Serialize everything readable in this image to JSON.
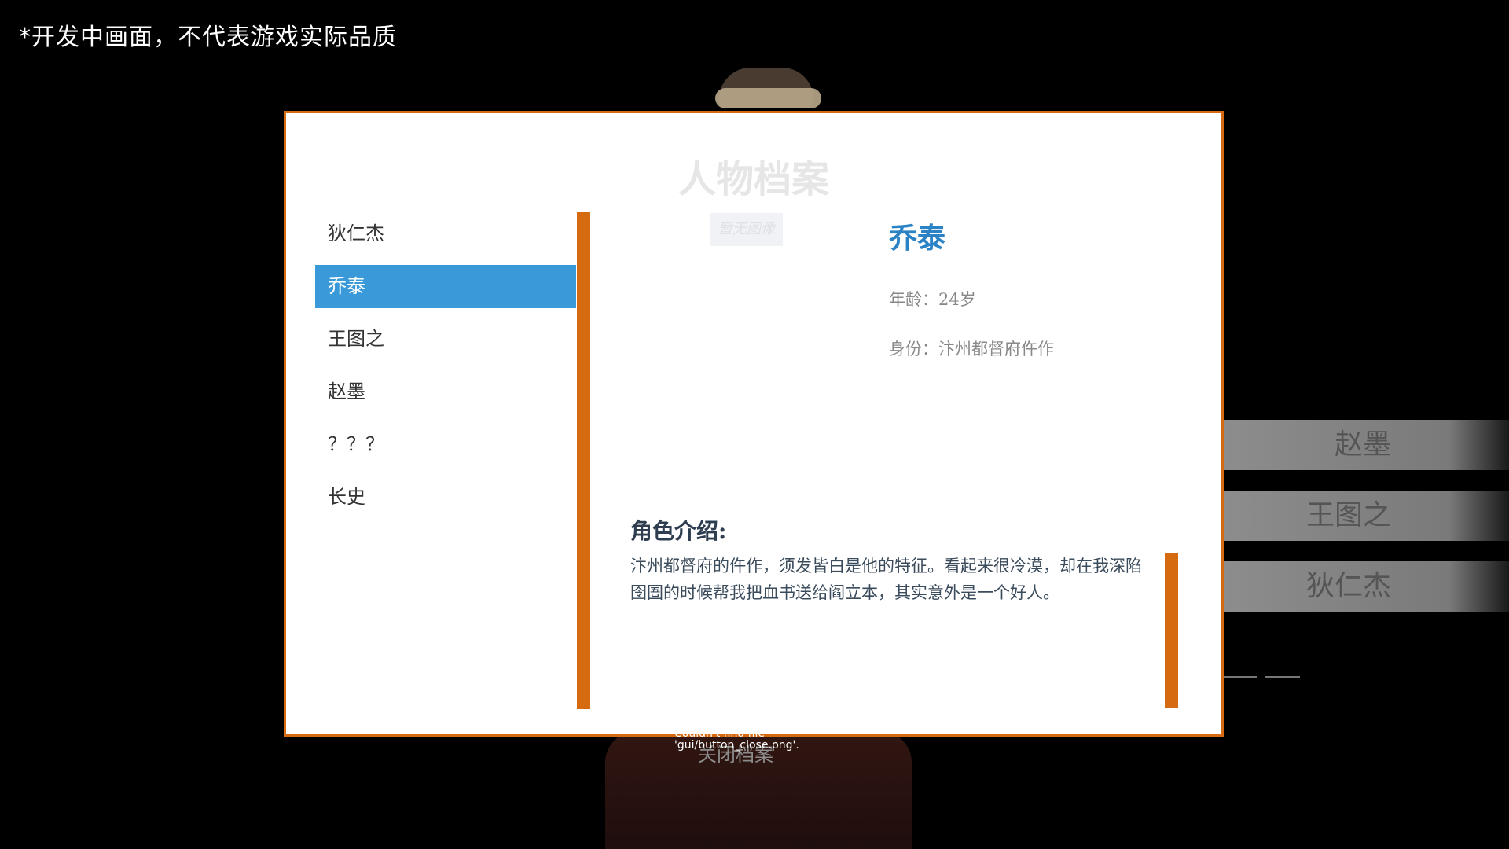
{
  "notice": "*开发中画面，不代表游戏实际品质",
  "side_menu": [
    "赵墨",
    "王图之",
    "狄仁杰"
  ],
  "dialog": {
    "title": "人物档案",
    "characters": [
      {
        "label": "狄仁杰",
        "active": false
      },
      {
        "label": "乔泰",
        "active": true
      },
      {
        "label": "王图之",
        "active": false
      },
      {
        "label": "赵墨",
        "active": false
      },
      {
        "label": "？？？",
        "active": false
      },
      {
        "label": "长史",
        "active": false
      }
    ],
    "portrait_placeholder": "暂无图像",
    "selected": {
      "name": "乔泰",
      "age": "年龄：24岁",
      "identity": "身份：汴州都督府仵作",
      "intro_heading": "角色介绍:",
      "intro_text": "汴州都督府的仵作，须发皆白是他的特征。看起来很冷漠，却在我深陷囹圄的时候帮我把血书送给阎立本，其实意外是一个好人。"
    }
  },
  "close_button": "关闭档案",
  "error_text": "Couldn't find file 'gui/button_close.png'.",
  "colors": {
    "accent_orange": "#d56a10",
    "selection_blue": "#3a9ad9",
    "name_blue": "#2b82c4"
  }
}
